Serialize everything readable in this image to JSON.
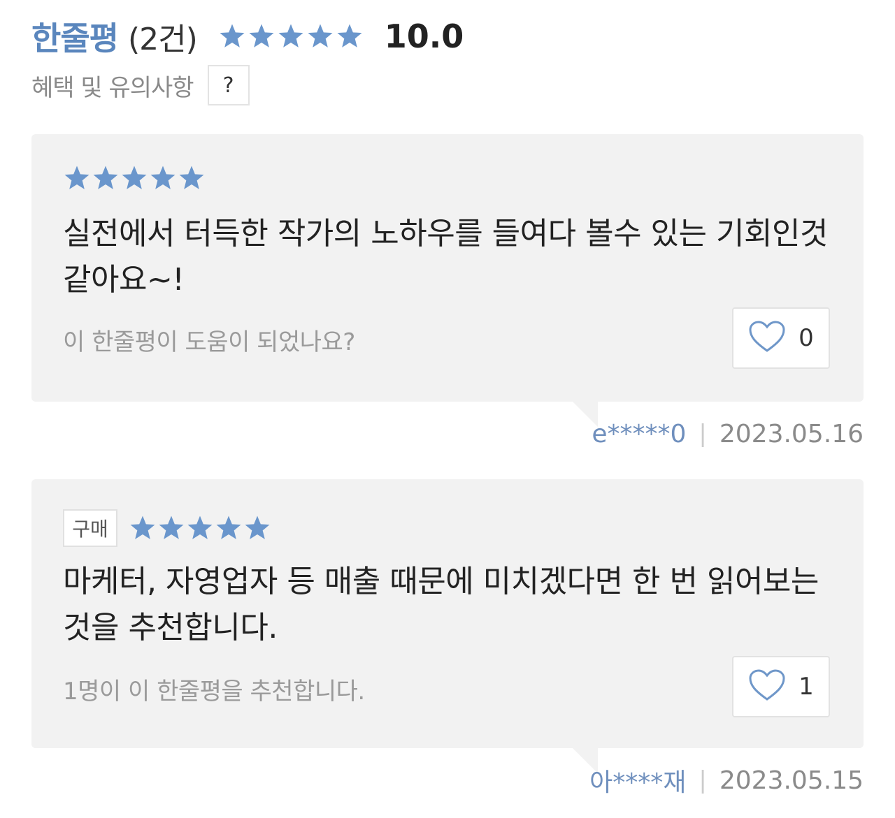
{
  "header": {
    "title": "한줄평",
    "count": "(2건)",
    "stars": 5,
    "score": "10.0"
  },
  "notice": {
    "label": "혜택 및 유의사항",
    "help_label": "?"
  },
  "reviews": [
    {
      "badge": "",
      "stars": 5,
      "text": "실전에서 터득한 작가의 노하우를 들여다 볼수 있는 기회인것같아요~!",
      "helpful_text": "이 한줄평이 도움이 되었나요?",
      "likes": "0",
      "author": "e*****0",
      "date": "2023.05.16"
    },
    {
      "badge": "구매",
      "stars": 5,
      "text": "마케터, 자영업자 등 매출 때문에 미치겠다면 한 번 읽어보는 것을 추천합니다.",
      "helpful_text": "1명이 이 한줄평을 추천합니다.",
      "likes": "1",
      "author": "아****재",
      "date": "2023.05.15"
    }
  ],
  "colors": {
    "accent": "#5a86bd",
    "star": "#6a96cc",
    "card_bg": "#f2f2f2"
  }
}
